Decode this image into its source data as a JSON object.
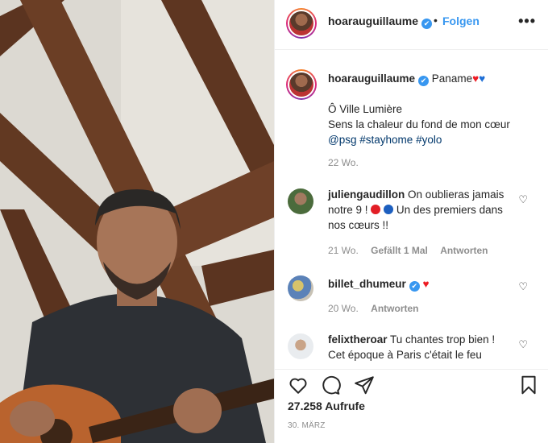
{
  "header": {
    "username": "hoarauguillaume",
    "verified_mark": "✔",
    "separator": "•",
    "follow_label": "Folgen",
    "more_label": "•••"
  },
  "caption": {
    "username": "hoarauguillaume",
    "first_text": "Paname",
    "heart1": "♥",
    "heart2": "♥",
    "line1": "Ô Ville Lumière",
    "line2": "Sens la chaleur du fond de mon cœur",
    "tag_mention": "@psg",
    "tag2": "#stayhome",
    "tag3": "#yolo",
    "time": "22 Wo."
  },
  "comments": [
    {
      "username": "juliengaudillon",
      "text_a": "On oublieras jamais notre 9 !",
      "text_b": "Un des premiers dans nos cœurs !!",
      "time": "21 Wo.",
      "likes": "Gefällt 1 Mal",
      "reply": "Antworten"
    },
    {
      "username": "billet_dhumeur",
      "heart": "♥",
      "time": "20 Wo.",
      "reply": "Antworten"
    },
    {
      "username": "felixtheroar",
      "text": "Tu chantes trop bien ! Cet époque à Paris c'était le feu"
    }
  ],
  "actions": {
    "views": "27.258 Aufrufe",
    "date": "30. MÄRZ"
  },
  "colors": {
    "accent": "#3897f0",
    "text": "#262626",
    "muted": "#8e8e8e"
  },
  "icons": [
    "heart-icon",
    "comment-icon",
    "share-icon",
    "bookmark-icon",
    "more-icon",
    "verified-icon"
  ]
}
